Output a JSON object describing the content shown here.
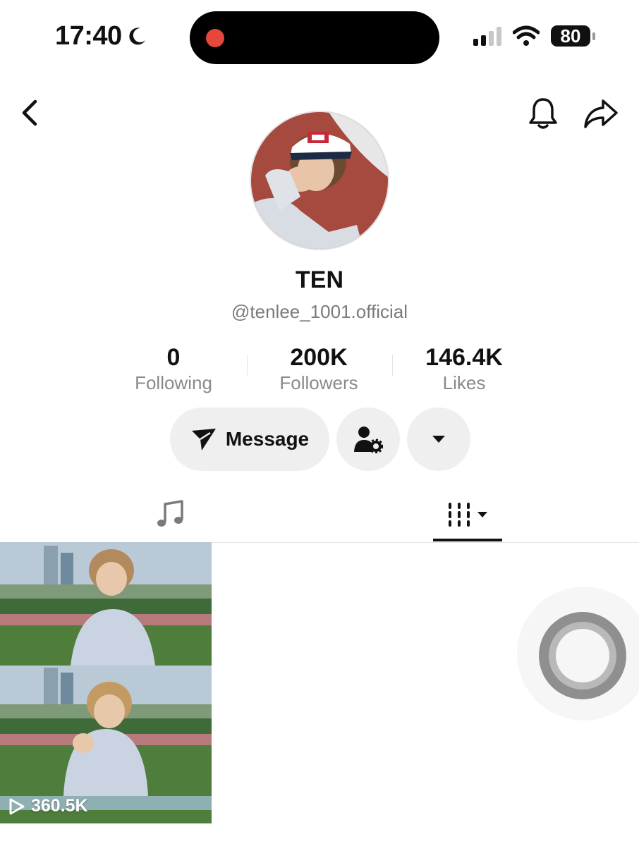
{
  "status_bar": {
    "time": "17:40",
    "battery": "80"
  },
  "profile": {
    "display_name": "TEN",
    "username": "@tenlee_1001.official"
  },
  "stats": [
    {
      "value": "0",
      "label": "Following"
    },
    {
      "value": "200K",
      "label": "Followers"
    },
    {
      "value": "146.4K",
      "label": "Likes"
    }
  ],
  "actions": {
    "message_label": "Message"
  },
  "videos": [
    {
      "views": "360.5K"
    }
  ],
  "icons": {
    "back": "chevron-left-icon",
    "notifications": "bell-icon",
    "share": "share-arrow-icon",
    "message": "paper-plane-icon",
    "follow_settings": "user-settings-icon",
    "more": "caret-down-icon",
    "music_tab": "music-note-icon",
    "videos_tab": "grid-bars-icon",
    "play": "play-outline-icon"
  },
  "colors": {
    "recording_dot": "#e5483a",
    "button_bg": "#efefef",
    "secondary_text": "#8a8a8a"
  }
}
